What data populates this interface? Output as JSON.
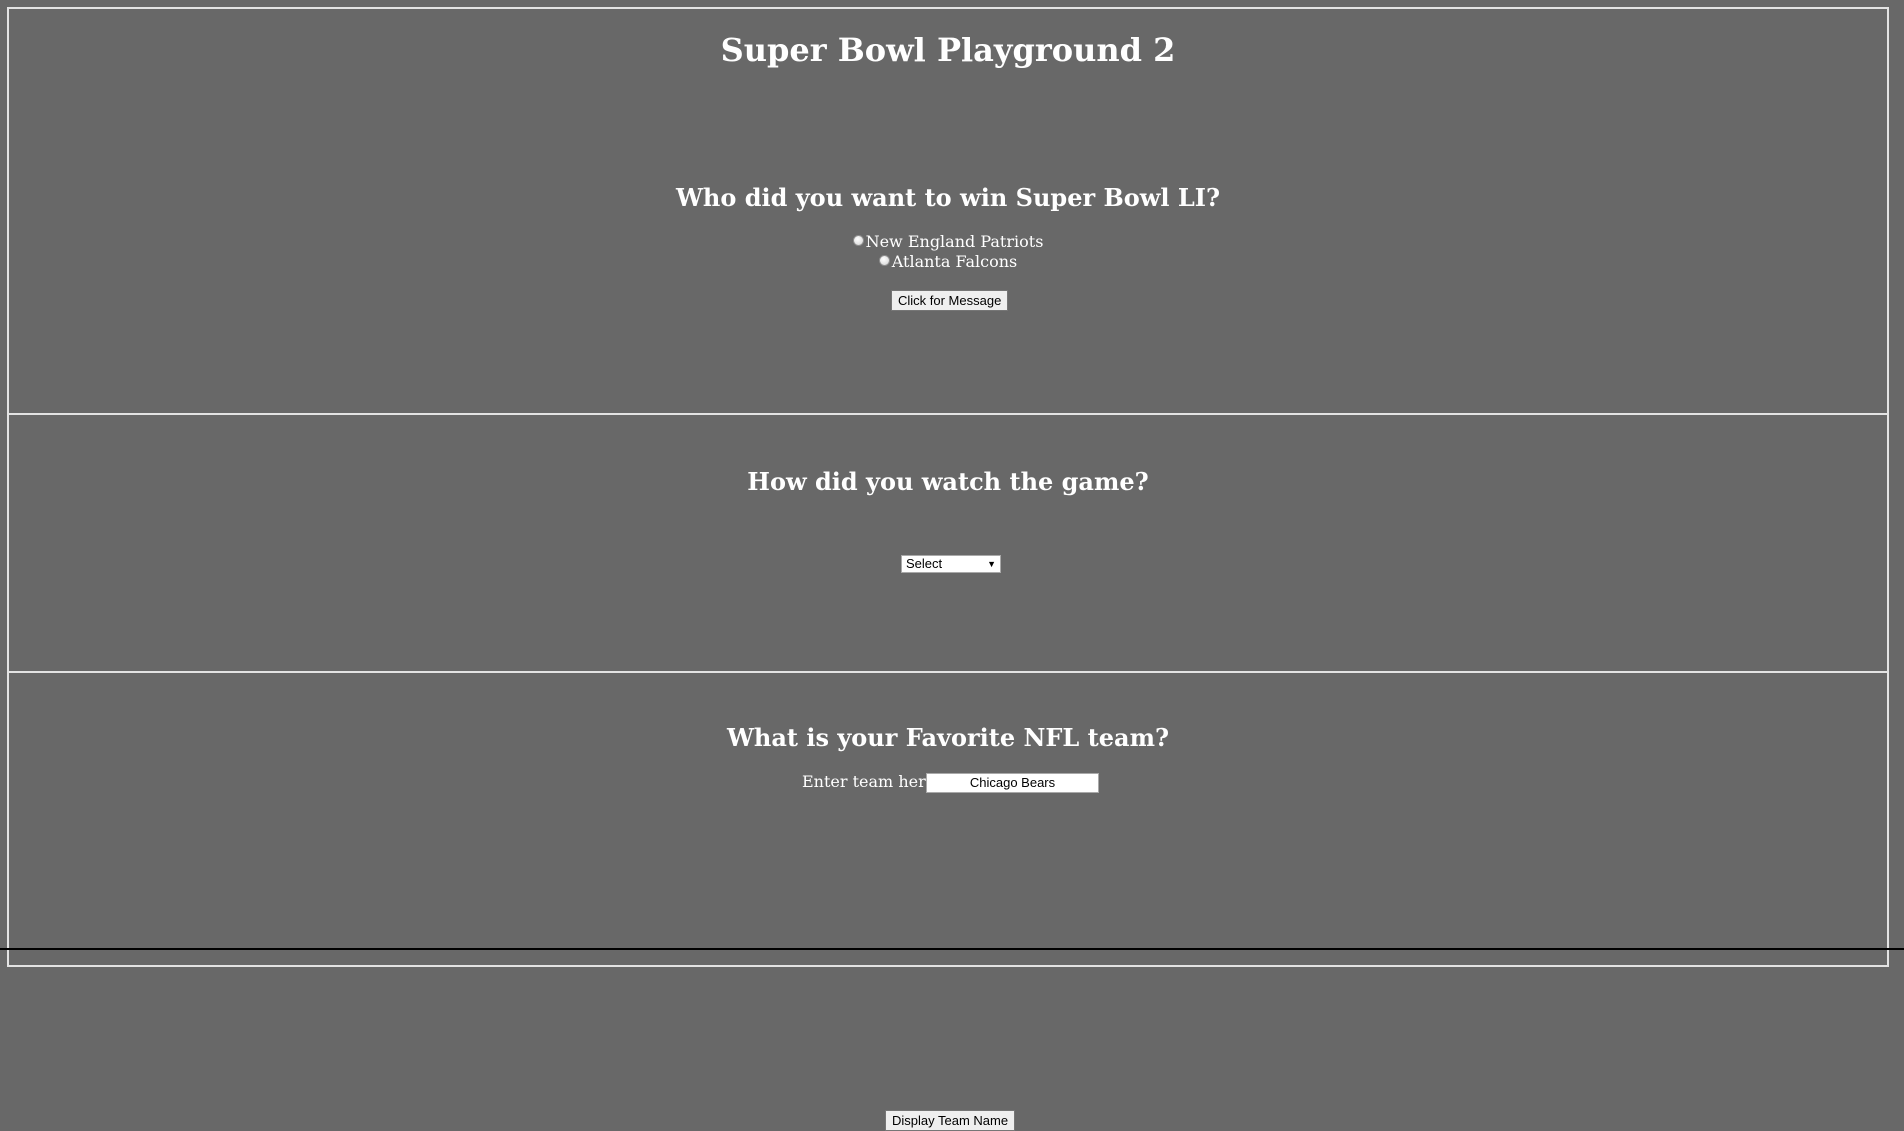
{
  "page": {
    "title": "Super Bowl Playground 2"
  },
  "question1": {
    "heading": "Who did you want to win Super Bowl LI?",
    "options": [
      "New England Patriots",
      "Atlanta Falcons"
    ],
    "button_label": "Click for Message"
  },
  "question2": {
    "heading": "How did you watch the game?",
    "select_value": "Select"
  },
  "question3": {
    "heading": "What is your Favorite NFL team?",
    "input_label": "Enter team here:",
    "input_value": "Chicago Bears",
    "button_label": "Display Team Name"
  },
  "colors": {
    "background": "#686868",
    "border": "#e3e3e3",
    "text": "#ffffff"
  }
}
